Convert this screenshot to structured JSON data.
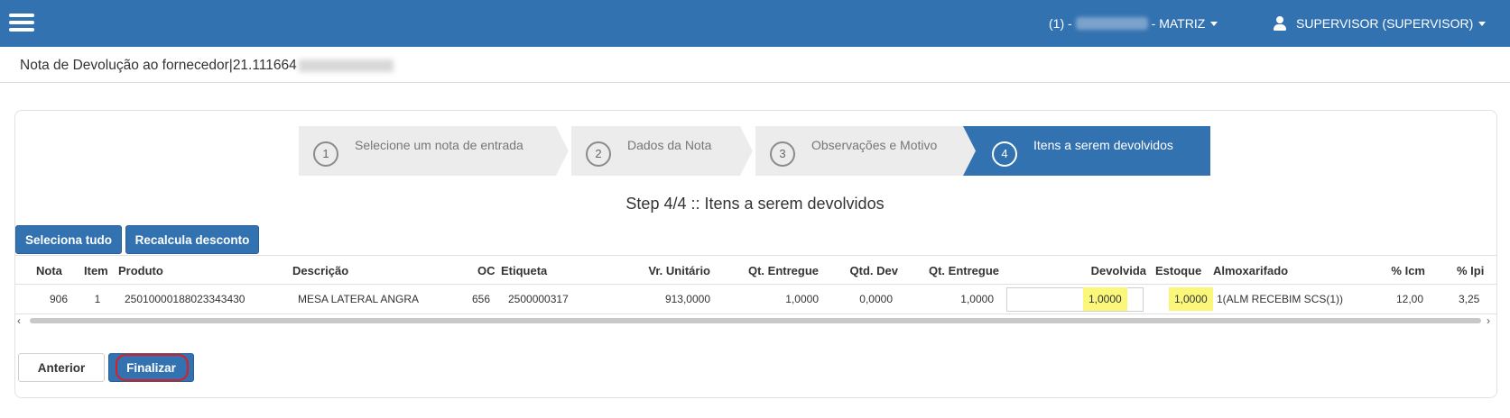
{
  "topbar": {
    "branch_prefix": "(1) - ",
    "branch_suffix": "- MATRIZ",
    "user": "SUPERVISOR (SUPERVISOR)",
    "menu_icon": "hamburger-icon",
    "user_icon": "user-icon"
  },
  "page": {
    "title": "Nota de Devolução ao fornecedor|21.111664"
  },
  "wizard": {
    "steps": [
      {
        "num": "1",
        "label": "Selecione um nota de entrada"
      },
      {
        "num": "2",
        "label": "Dados da Nota"
      },
      {
        "num": "3",
        "label": "Observações e Motivo"
      },
      {
        "num": "4",
        "label": "Itens a serem devolvidos"
      }
    ],
    "active_step": 4,
    "heading": "Step 4/4 :: Itens a serem devolvidos"
  },
  "actions": {
    "select_all": "Seleciona tudo",
    "recalc_discount": "Recalcula desconto",
    "previous": "Anterior",
    "finish": "Finalizar"
  },
  "table": {
    "headers": {
      "nota": "Nota",
      "item": "Item",
      "produto": "Produto",
      "descricao": "Descrição",
      "oc": "OC",
      "etiqueta": "Etiqueta",
      "vr_unitario": "Vr. Unitário",
      "qt_entregue": "Qt. Entregue",
      "qtd_dev": "Qtd. Dev",
      "qt_entregue2": "Qt. Entregue",
      "devolvida": "Devolvida",
      "estoque": "Estoque",
      "almoxarifado": "Almoxarifado",
      "pct_icm": "% Icm",
      "pct_ipi": "% Ipi"
    },
    "rows": [
      {
        "nota": "906",
        "item": "1",
        "produto": "25010000188023343430",
        "descricao": "MESA LATERAL ANGRA",
        "oc": "656",
        "etiqueta": "2500000317",
        "vr_unitario": "913,0000",
        "qt_entregue": "1,0000",
        "qtd_dev": "0,0000",
        "qt_entregue2": "1,0000",
        "devolvida": "1,0000",
        "estoque": "1,0000",
        "almoxarifado": "1(ALM RECEBIM SCS(1))",
        "pct_icm": "12,00",
        "pct_ipi": "3,25"
      }
    ]
  },
  "colors": {
    "primary": "#3372b1",
    "highlight": "#faf77a",
    "annotation": "#e01c1c"
  }
}
